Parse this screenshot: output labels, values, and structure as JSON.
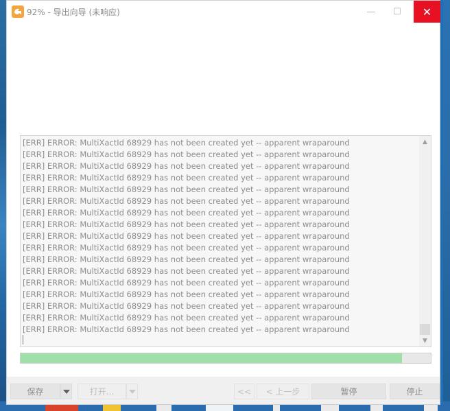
{
  "window": {
    "title": "92% - 导出向导 (未响应)",
    "controls": {
      "minimize": "—",
      "maximize": "☐",
      "close": "✕"
    }
  },
  "log": {
    "lines": [
      "[ERR] ERROR:  MultiXactId 68929 has not been created yet -- apparent wraparound",
      "[ERR] ERROR:  MultiXactId 68929 has not been created yet -- apparent wraparound",
      "[ERR] ERROR:  MultiXactId 68929 has not been created yet -- apparent wraparound",
      "[ERR] ERROR:  MultiXactId 68929 has not been created yet -- apparent wraparound",
      "[ERR] ERROR:  MultiXactId 68929 has not been created yet -- apparent wraparound",
      "[ERR] ERROR:  MultiXactId 68929 has not been created yet -- apparent wraparound",
      "[ERR] ERROR:  MultiXactId 68929 has not been created yet -- apparent wraparound",
      "[ERR] ERROR:  MultiXactId 68929 has not been created yet -- apparent wraparound",
      "[ERR] ERROR:  MultiXactId 68929 has not been created yet -- apparent wraparound",
      "[ERR] ERROR:  MultiXactId 68929 has not been created yet -- apparent wraparound",
      "[ERR] ERROR:  MultiXactId 68929 has not been created yet -- apparent wraparound",
      "[ERR] ERROR:  MultiXactId 68929 has not been created yet -- apparent wraparound",
      "[ERR] ERROR:  MultiXactId 68929 has not been created yet -- apparent wraparound",
      "[ERR] ERROR:  MultiXactId 68929 has not been created yet -- apparent wraparound",
      "[ERR] ERROR:  MultiXactId 68929 has not been created yet -- apparent wraparound",
      "[ERR] ERROR:  MultiXactId 68929 has not been created yet -- apparent wraparound",
      "[ERR] ERROR:  MultiXactId 68929 has not been created yet -- apparent wraparound"
    ]
  },
  "progress": {
    "fraction": 0.93,
    "color": "#9fe0a8"
  },
  "buttons": {
    "save": "保存",
    "open": "打开...",
    "first": "<<",
    "prev": "< 上一步",
    "pause": "暂停",
    "stop": "停止"
  },
  "colors": {
    "close_bg": "#e81123",
    "accent": "#1f6fb4"
  }
}
